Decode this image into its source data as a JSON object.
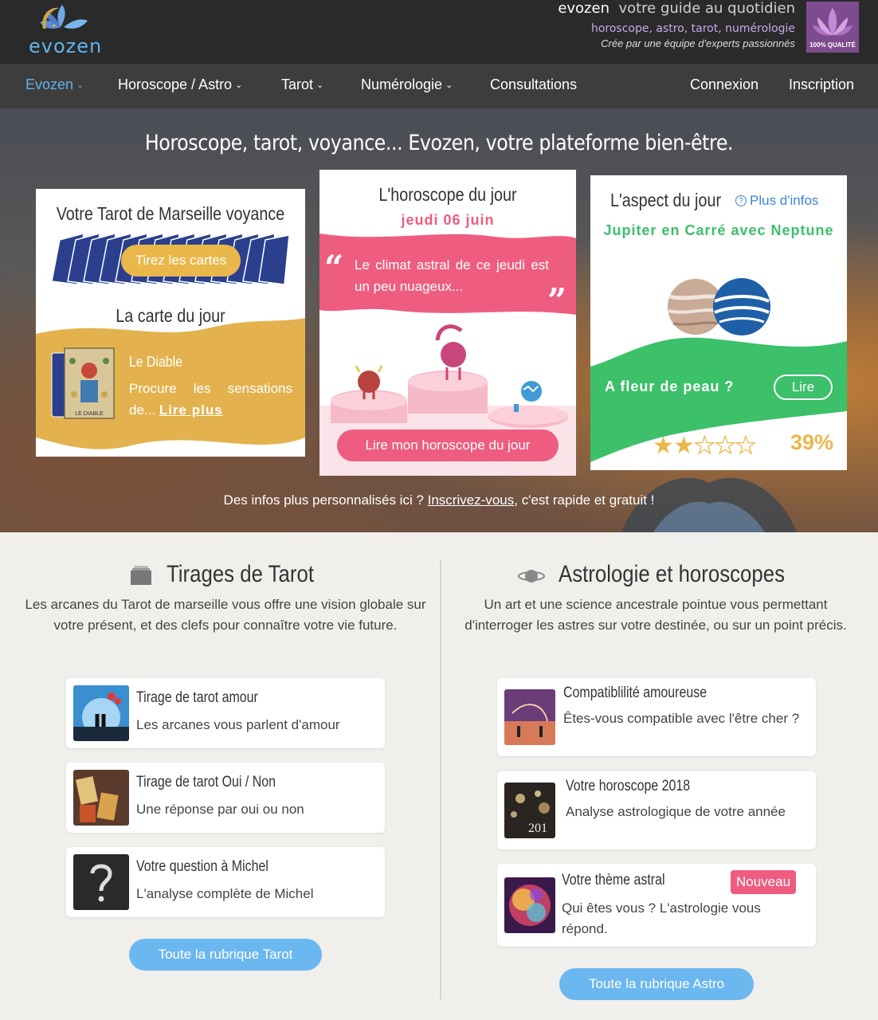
{
  "header": {
    "logo_text": "evozen",
    "brand": "evozen",
    "tagline": "votre guide au quotidien",
    "topics": "horoscope, astro, tarot, numérologie",
    "subtitle": "Crée par une équipe d'experts passionnés",
    "quality_badge": "100% QUALITÉ"
  },
  "nav": {
    "items": [
      {
        "label": "Evozen"
      },
      {
        "label": "Horoscope / Astro"
      },
      {
        "label": "Tarot"
      },
      {
        "label": "Numérologie"
      },
      {
        "label": "Consultations"
      }
    ],
    "login": "Connexion",
    "signup": "Inscription"
  },
  "hero": {
    "title": "Horoscope, tarot, voyance... Evozen, votre plateforme bien-être.",
    "footer_before": "Des infos plus personnalisés ici ? ",
    "footer_link": "Inscrivez-vous",
    "footer_after": ", c'est rapide et gratuit !"
  },
  "tarot_card": {
    "title": "Votre Tarot de Marseille voyance",
    "button": "Tirez les cartes",
    "daily_title": "La carte du jour",
    "card_name": "Le Diable",
    "card_image_label": "LE DIABLE",
    "card_desc": "Procure les sensations de...",
    "read_more": "Lire plus"
  },
  "horoscope_card": {
    "title": "L'horoscope du jour",
    "date": "jeudi 06 juin",
    "quote": "Le climat astral de ce jeudi est un peu nuageux...",
    "button": "Lire mon horoscope du jour"
  },
  "aspect_card": {
    "title": "L'aspect du jour",
    "more_info": "Plus d'infos",
    "aspect": "Jupiter en Carré avec Neptune",
    "headline": "A fleur de peau ?",
    "button": "Lire",
    "rating_stars": 2,
    "rating_max": 5,
    "percent": "39%"
  },
  "tarot_section": {
    "title": "Tirages de Tarot",
    "description": "Les arcanes du Tarot de marseille vous offre une vision globale sur votre présent, et des clefs pour connaître votre vie future.",
    "items": [
      {
        "title": "Tirage de tarot amour",
        "desc": "Les arcanes vous parlent d'amour"
      },
      {
        "title": "Tirage de tarot Oui / Non",
        "desc": "Une réponse par oui ou non"
      },
      {
        "title": "Votre question à Michel",
        "desc": "L'analyse complète de Michel"
      }
    ],
    "button": "Toute la rubrique Tarot"
  },
  "astro_section": {
    "title": "Astrologie et horoscopes",
    "description": "Un art et une science ancestrale pointue vous permettant d'interroger les astres sur votre destinée, ou sur un point précis.",
    "items": [
      {
        "title": "Compatiblilité amoureuse",
        "desc": "Êtes-vous compatible avec l'être cher ?"
      },
      {
        "title": "Votre horoscope 2018",
        "desc": "Analyse astrologique de votre année",
        "thumb_text": "201"
      },
      {
        "title": "Votre thème astral",
        "desc": "Qui êtes vous ? L'astrologie vous répond.",
        "badge": "Nouveau"
      }
    ],
    "button": "Toute la rubrique Astro"
  },
  "colors": {
    "accent_blue": "#6bb7f0",
    "pink": "#ee5d7f",
    "yellow": "#eab74a",
    "green": "#3cc06a",
    "nav_bg": "#3d3d3d"
  }
}
